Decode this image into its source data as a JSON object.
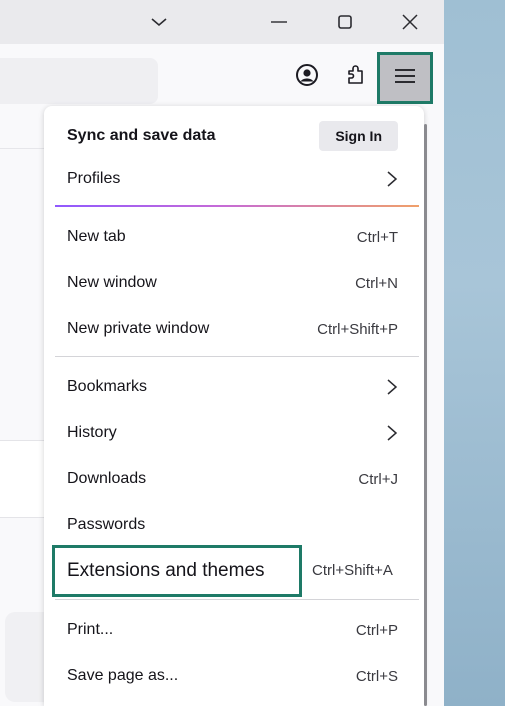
{
  "window": {
    "controls": [
      "chevron-down-icon",
      "minimize-icon",
      "maximize-icon",
      "close-icon"
    ]
  },
  "toolbar": {
    "icons": [
      "account-icon",
      "extensions-icon",
      "hamburger-menu-icon"
    ]
  },
  "menu": {
    "sync_title": "Sync and save data",
    "sign_in_label": "Sign In",
    "profiles_label": "Profiles",
    "new_tab": {
      "label": "New tab",
      "shortcut": "Ctrl+T"
    },
    "new_window": {
      "label": "New window",
      "shortcut": "Ctrl+N"
    },
    "new_private_window": {
      "label": "New private window",
      "shortcut": "Ctrl+Shift+P"
    },
    "bookmarks_label": "Bookmarks",
    "history_label": "History",
    "downloads": {
      "label": "Downloads",
      "shortcut": "Ctrl+J"
    },
    "passwords_label": "Passwords",
    "extensions": {
      "label": "Extensions and themes",
      "shortcut": "Ctrl+Shift+A"
    },
    "print": {
      "label": "Print...",
      "shortcut": "Ctrl+P"
    },
    "save_page": {
      "label": "Save page as...",
      "shortcut": "Ctrl+S"
    }
  },
  "colors": {
    "highlight_border": "#1e7a67",
    "gradient_separator": [
      "#9059ff",
      "#c56ad8",
      "#f0a06a"
    ]
  }
}
